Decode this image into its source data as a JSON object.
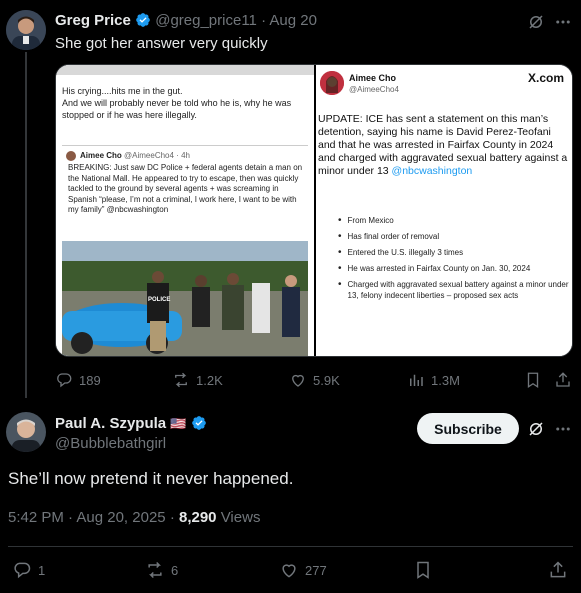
{
  "tweet1": {
    "author_name": "Greg Price",
    "handle": "@greg_price11",
    "date": "Aug 20",
    "text": "She got her answer very quickly",
    "actions": {
      "replies": "189",
      "reposts": "1.2K",
      "likes": "5.9K",
      "views": "1.3M"
    }
  },
  "media_left": {
    "quote_text": "His crying....hits me in the gut.\nAnd we will probably never be told who he is, why he was stopped or if he was here illegally.",
    "inner_author": "Aimee Cho",
    "inner_handle": "@AimeeCho4",
    "inner_time": "4h",
    "inner_text": "BREAKING: Just saw DC Police + federal agents detain a man on the National Mall. He appeared to try to escape, then was quickly tackled to the ground by several agents + was screaming in Spanish “please, I’m not a criminal, I work here, I want to be with my family” @nbcwashington",
    "vest_text": "POLICE"
  },
  "media_right": {
    "author": "Aimee Cho",
    "handle": "@AimeeCho4",
    "brand": "X.com",
    "update_text": "UPDATE: ICE has sent a statement on this man’s detention, saying his name is David Perez-Teofani and that he was arrested in Fairfax County in 2024 and charged with aggravated sexual battery against a minor under 13",
    "mention": "@nbcwashington",
    "bullets": [
      "From Mexico",
      "Has final order of removal",
      "Entered the U.S. illegally 3 times",
      "He was arrested in Fairfax County on Jan. 30, 2024",
      "Charged with aggravated sexual battery against a minor under 13, felony indecent liberties – proposed sex acts"
    ]
  },
  "tweet2": {
    "author_name": "Paul A. Szypula",
    "flag": "🇺🇸",
    "handle": "@Bubblebathgirl",
    "subscribe_label": "Subscribe",
    "text": "She’ll now pretend it never happened.",
    "time": "5:42 PM",
    "date": "Aug 20, 2025",
    "views_count": "8,290",
    "views_label": "Views",
    "actions": {
      "replies": "1",
      "reposts": "6",
      "likes": "277"
    }
  },
  "colors": {
    "accent": "#1d9bf0",
    "background": "#000000",
    "muted": "#71767b"
  },
  "icons": [
    "verified-badge-icon",
    "grok-icon",
    "more-icon",
    "reply-icon",
    "repost-icon",
    "like-icon",
    "views-icon",
    "bookmark-icon",
    "share-icon",
    "us-flag-icon"
  ]
}
